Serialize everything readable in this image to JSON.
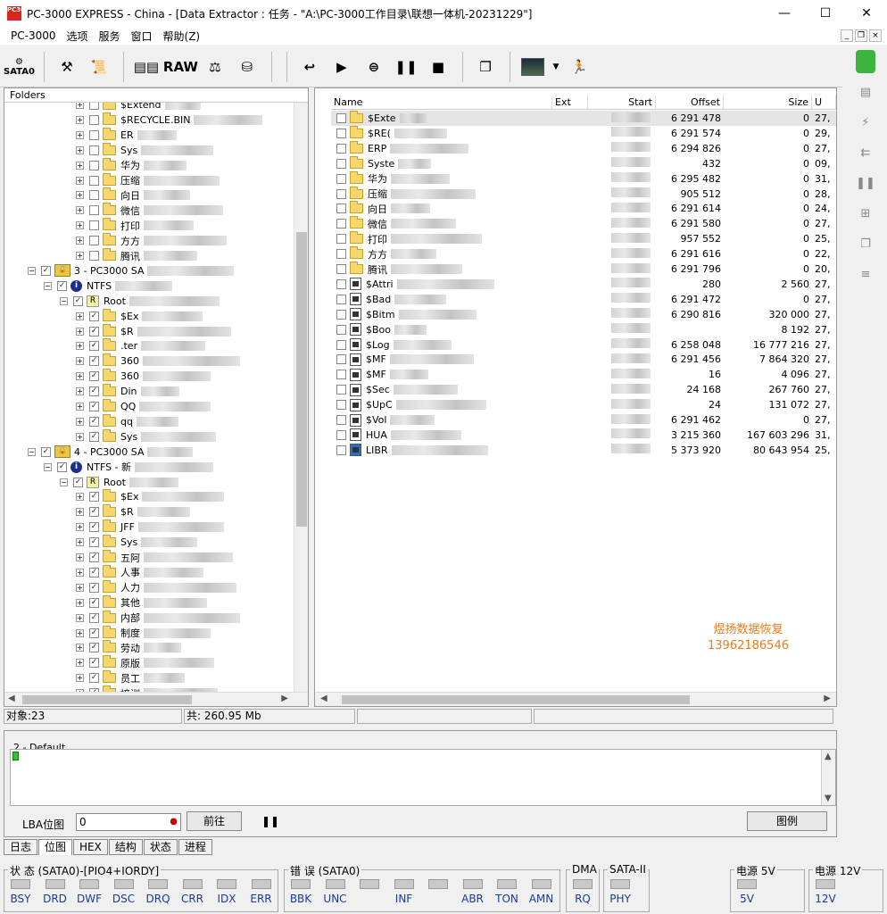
{
  "window": {
    "title": "PC-3000 EXPRESS - China - [Data Extractor : 任务 - \"A:\\PC-3000工作目录\\联想一体机-20231229\"]",
    "app_icon_text": "PC3000"
  },
  "menu": [
    "PC-3000",
    "选项",
    "服务",
    "窗口",
    "帮助(Z)"
  ],
  "toolbar": {
    "port_label": "SATA0",
    "raw_label": "RAW"
  },
  "left_panel": {
    "header": "Folders",
    "rows": [
      {
        "text": "$Extend",
        "level": 3,
        "partial": true
      },
      {
        "text": "$RECYCLE.BIN",
        "level": 3
      },
      {
        "text": "ER",
        "level": 3
      },
      {
        "text": "Sys",
        "level": 3
      },
      {
        "text": "华为",
        "level": 3
      },
      {
        "text": "压缩",
        "level": 3
      },
      {
        "text": "向日",
        "level": 3
      },
      {
        "text": "微信",
        "level": 3
      },
      {
        "text": "打印",
        "level": 3
      },
      {
        "text": "方方",
        "level": 3
      },
      {
        "text": "腾讯",
        "level": 3
      },
      {
        "text": "3 - PC3000 SA",
        "level": 0,
        "type": "drive",
        "checked": true
      },
      {
        "text": "NTFS",
        "level": 1,
        "type": "fs",
        "checked": true
      },
      {
        "text": "Root",
        "level": 2,
        "type": "root",
        "checked": true
      },
      {
        "text": "$Ex",
        "level": 3,
        "checked": true
      },
      {
        "text": "$R",
        "level": 3,
        "checked": true
      },
      {
        "text": ".ter",
        "level": 3,
        "checked": true
      },
      {
        "text": "360",
        "level": 3,
        "checked": true
      },
      {
        "text": "360",
        "level": 3,
        "checked": true
      },
      {
        "text": "Din",
        "level": 3,
        "checked": true
      },
      {
        "text": "QQ",
        "level": 3,
        "checked": true
      },
      {
        "text": "qq",
        "level": 3,
        "checked": true
      },
      {
        "text": "Sys",
        "level": 3,
        "checked": true
      },
      {
        "text": "4 - PC3000 SA",
        "level": 0,
        "type": "drive",
        "checked": true
      },
      {
        "text": "NTFS - 新",
        "level": 1,
        "type": "fs",
        "checked": true
      },
      {
        "text": "Root",
        "level": 2,
        "type": "root",
        "checked": true
      },
      {
        "text": "$Ex",
        "level": 3,
        "checked": true
      },
      {
        "text": "$R",
        "level": 3,
        "checked": true
      },
      {
        "text": "JFF",
        "level": 3,
        "checked": true
      },
      {
        "text": "Sys",
        "level": 3,
        "checked": true
      },
      {
        "text": "五阿",
        "level": 3,
        "checked": true
      },
      {
        "text": "人事",
        "level": 3,
        "checked": true
      },
      {
        "text": "人力",
        "level": 3,
        "checked": true
      },
      {
        "text": "其他",
        "level": 3,
        "checked": true
      },
      {
        "text": "内部",
        "level": 3,
        "checked": true
      },
      {
        "text": "制度",
        "level": 3,
        "checked": true
      },
      {
        "text": "劳动",
        "level": 3,
        "checked": true
      },
      {
        "text": "原版",
        "level": 3,
        "checked": true
      },
      {
        "text": "员工",
        "level": 3,
        "checked": true
      },
      {
        "text": "培训",
        "level": 3,
        "checked": true
      }
    ]
  },
  "file_list": {
    "columns": [
      "Name",
      "Ext",
      "Start",
      "Offset",
      "Size",
      "U"
    ],
    "rows": [
      {
        "name": "$Exte",
        "icon": "folder",
        "offset": "6 291 478",
        "size": "0",
        "extra": "27,"
      },
      {
        "name": "$RE(",
        "icon": "folder",
        "offset": "6 291 574",
        "size": "0",
        "extra": "29,"
      },
      {
        "name": "ERP",
        "icon": "folder",
        "offset": "6 294 826",
        "size": "0",
        "extra": "27,"
      },
      {
        "name": "Syste",
        "icon": "folder",
        "offset": "432",
        "size": "0",
        "extra": "09,"
      },
      {
        "name": "华为",
        "icon": "folder",
        "offset": "6 295 482",
        "size": "0",
        "extra": "31,"
      },
      {
        "name": "压缩",
        "icon": "folder",
        "offset": "905 512",
        "size": "0",
        "extra": "28,"
      },
      {
        "name": "向日",
        "icon": "folder",
        "offset": "6 291 614",
        "size": "0",
        "extra": "24,"
      },
      {
        "name": "微信",
        "icon": "folder",
        "offset": "6 291 580",
        "size": "0",
        "extra": "27,"
      },
      {
        "name": "打印",
        "icon": "folder",
        "offset": "957 552",
        "size": "0",
        "extra": "25,"
      },
      {
        "name": "方方",
        "icon": "folder",
        "offset": "6 291 616",
        "size": "0",
        "extra": "22,"
      },
      {
        "name": "腾讯",
        "icon": "folder",
        "offset": "6 291 796",
        "size": "0",
        "extra": "20,"
      },
      {
        "name": "$Attri",
        "icon": "file",
        "offset": "280",
        "size": "2 560",
        "extra": "27,"
      },
      {
        "name": "$Bad",
        "icon": "file",
        "offset": "6 291 472",
        "size": "0",
        "extra": "27,"
      },
      {
        "name": "$Bitm",
        "icon": "file",
        "offset": "6 290 816",
        "size": "320 000",
        "extra": "27,"
      },
      {
        "name": "$Boo",
        "icon": "file",
        "offset": "",
        "size": "8 192",
        "extra": "27,"
      },
      {
        "name": "$Log",
        "icon": "file",
        "offset": "6 258 048",
        "size": "16 777 216",
        "extra": "27,"
      },
      {
        "name": "$MF",
        "icon": "file",
        "offset": "6 291 456",
        "size": "7 864 320",
        "extra": "27,"
      },
      {
        "name": "$MF",
        "icon": "file",
        "offset": "16",
        "size": "4 096",
        "extra": "27,"
      },
      {
        "name": "$Sec",
        "icon": "file",
        "offset": "24 168",
        "size": "267 760",
        "extra": "27,"
      },
      {
        "name": "$UpC",
        "icon": "file",
        "offset": "24",
        "size": "131 072",
        "extra": "27,"
      },
      {
        "name": "$Vol",
        "icon": "file",
        "offset": "6 291 462",
        "size": "0",
        "extra": "27,"
      },
      {
        "name": "HUA",
        "icon": "file",
        "offset": "3 215 360",
        "size": "167 603 296",
        "extra": "31,"
      },
      {
        "name": "LIBR",
        "icon": "img",
        "offset": "5 373 920",
        "size": "80 643 954",
        "extra": "25,"
      }
    ],
    "watermark_line1": "煜扬数据恢复",
    "watermark_line2": "13962186546"
  },
  "status": {
    "objects": "对象:23",
    "total": "共: 260.95 Mb"
  },
  "log_panel": {
    "group": "2 - Default",
    "lba_label": "LBA位图",
    "lba_value": "0",
    "go_button": "前往",
    "legend_button": "图例"
  },
  "tabs": [
    "日志",
    "位图",
    "HEX",
    "结构",
    "状态",
    "进程"
  ],
  "indicators": {
    "status_group": "状 态 (SATA0)-[PIO4+IORDY]",
    "status_leds": [
      "BSY",
      "DRD",
      "DWF",
      "DSC",
      "DRQ",
      "CRR",
      "IDX",
      "ERR"
    ],
    "error_group": "错 误 (SATA0)",
    "error_leds": [
      "BBK",
      "UNC",
      "",
      "INF",
      "",
      "ABR",
      "TON",
      "AMN"
    ],
    "dma_group": "DMA",
    "dma_leds": [
      "RQ"
    ],
    "sata_group": "SATA-II",
    "sata_leds": [
      "PHY"
    ],
    "power5_group": "电源 5V",
    "power5_leds": [
      "5V"
    ],
    "power12_group": "电源 12V",
    "power12_leds": [
      "12V"
    ]
  },
  "colors": {
    "watermark": "#f07a1a",
    "led_label": "#1a3a9a",
    "folder": "#f5d76e"
  }
}
